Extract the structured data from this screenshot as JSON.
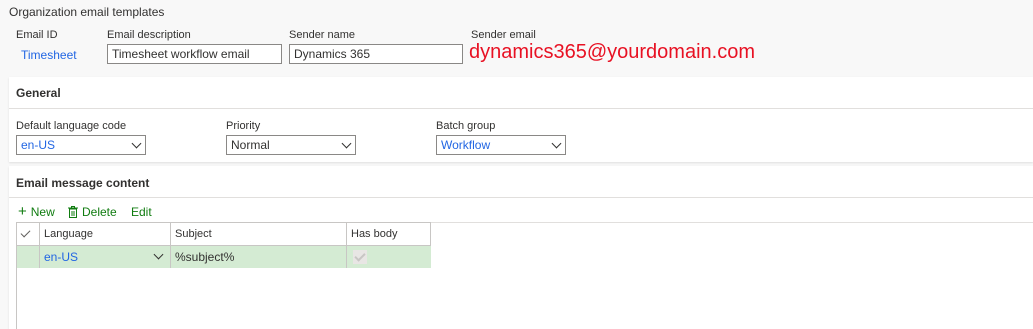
{
  "page": {
    "title": "Organization email templates"
  },
  "header": {
    "email_id_label": "Email ID",
    "email_id_value": "Timesheet",
    "email_description_label": "Email description",
    "email_description_value": "Timesheet workflow email",
    "sender_name_label": "Sender name",
    "sender_name_value": "Dynamics 365",
    "sender_email_label": "Sender email",
    "sender_email_value": "dynamics365@yourdomain.com"
  },
  "general": {
    "title": "General",
    "default_language_label": "Default language code",
    "default_language_value": "en-US",
    "priority_label": "Priority",
    "priority_value": "Normal",
    "batch_group_label": "Batch group",
    "batch_group_value": "Workflow"
  },
  "content": {
    "title": "Email message content",
    "toolbar": {
      "new_label": "New",
      "delete_label": "Delete",
      "edit_label": "Edit"
    },
    "grid": {
      "columns": [
        "Language",
        "Subject",
        "Has body"
      ],
      "rows": [
        {
          "language": "en-US",
          "subject": "%subject%",
          "has_body": true
        }
      ]
    }
  },
  "colors": {
    "accent_blue": "#2266e3",
    "link_green": "#107c10",
    "selected_row": "#d4ebd3",
    "annotation_red": "#e81123"
  }
}
